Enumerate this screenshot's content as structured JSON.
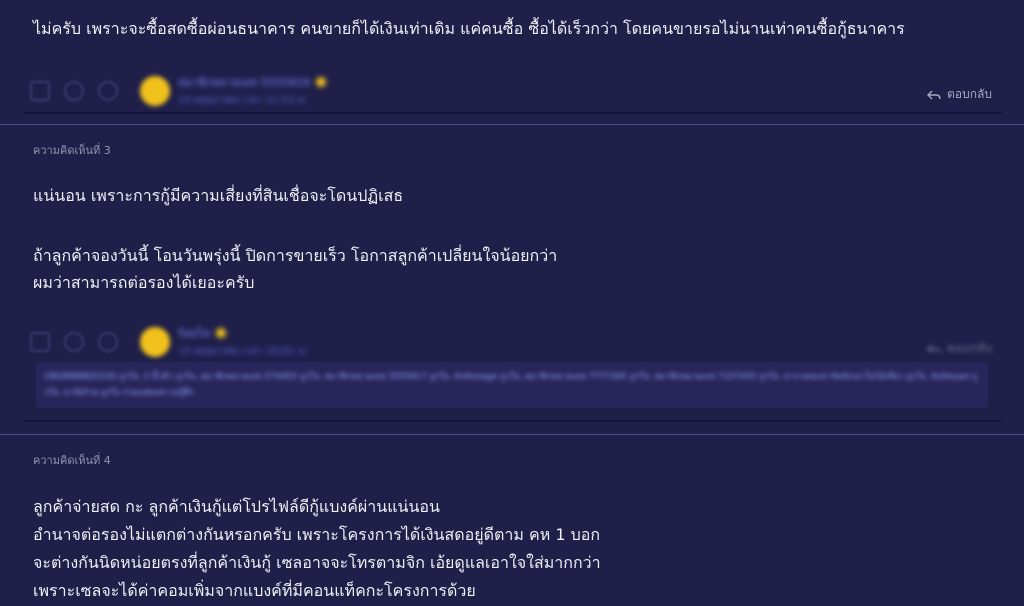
{
  "comment_top": {
    "body": "ไม่ครับ เพราะจะซื้อสดซื้อผ่อนธนาคาร คนขายก็ได้เงินเท่าเดิม แค่คนซื้อ ซื้อได้เร็วกว่า โดยคนขายรอไม่นานเท่าคนซื้อกู้ธนาคาร",
    "author_name": "สมาชิกหมายเลข 5555919",
    "author_timestamp": "15 พฤษภาคม เวลา 11:53 น.",
    "reply_label": "ตอบกลับ"
  },
  "comment_3": {
    "label": "ความคิดเห็นที่ 3",
    "lines": [
      "แน่นอน เพราะการกู้มีความเสี่ยงที่สินเชื่อจะโดนปฏิเสธ",
      "",
      "ถ้าลูกค้าจองวันนี้ โอนวันพรุ่งนี้ ปิดการขายเร็ว โอกาสลูกค้าเปลี่ยนใจน้อยกว่า",
      "ผมว่าสามารถต่อรองได้เยอะครับ"
    ],
    "author_name": "ร้อยโท",
    "author_timestamp": "15 พฤษภาคม เวลา 10:01 น.",
    "reply_label": "ตอบกลับ",
    "signature": "CBG8988820330 ถูกใจ, 2 นิ้วห้า ถูกใจ, สมาชิกหมายเลข 574455 ถูกใจ, สมาชิกหมายเลข 5555917 ถูกใจ, Ardrosage ถูกใจ, สมาชิกหมายเลข 7777265 ถูกใจ, สมาชิกหมายเลข 7107455 ถูกใจ, ธาราเดอะดาร์คนักเล่าใบไม้เขียว ถูกใจ, Ardreyan ถูกใจ, ฮาร์ดร้าย ถูกใจ ร่วมแสดงความรู้สึก"
  },
  "comment_4": {
    "label": "ความคิดเห็นที่ 4",
    "lines": [
      "ลูกค้าจ่ายสด กะ ลูกค้าเงินกู้แต่โปรไฟล์ดีกู้แบงค์ผ่านแน่นอน",
      "อำนาจต่อรองไม่แตกต่างกันหรอกครับ เพราะโครงการได้เงินสดอยู่ดีตาม คห 1 บอก",
      "จะต่างกันนิดหน่อยตรงที่ลูกค้าเงินกู้ เซลอาจจะโทรตามจิก เอ้ยดูแลเอาใจใส่มากกว่า",
      "เพราะเซลจะได้ค่าคอมเพิ่มจากแบงค์ที่มีคอนแท็คกะโครงการด้วย"
    ]
  },
  "colors": {
    "background": "#1f1f4a",
    "divider": "#4d4d88",
    "username_link": "#7f86ff",
    "avatar": "#f2c21c"
  },
  "icons": [
    "vote-up-icon",
    "emoji-icon",
    "more-icon",
    "reply-arrow-icon",
    "star-badge-icon"
  ]
}
